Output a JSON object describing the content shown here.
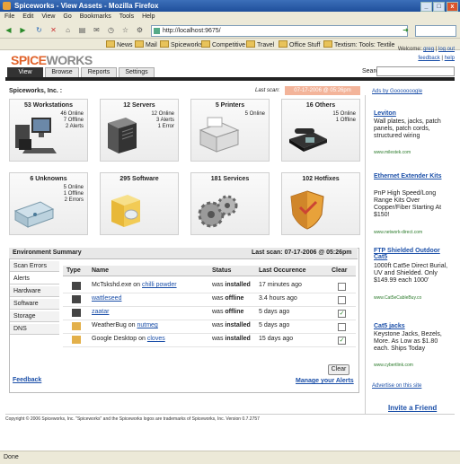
{
  "window": {
    "title": "Spiceworks - View Assets - Mozilla Firefox"
  },
  "menu": [
    "File",
    "Edit",
    "View",
    "Go",
    "Bookmarks",
    "Tools",
    "Help"
  ],
  "nav": {
    "url": "http://localhost:9675/"
  },
  "bookmarks": [
    "News",
    "Mail",
    "Spiceworks",
    "Competitive",
    "Travel",
    "Office Stuff",
    "Textism: Tools: Textile"
  ],
  "header": {
    "logo_left": "SPICE",
    "logo_right": "WORKS",
    "welcome_prefix": "Welcome:",
    "user": "greg",
    "logout": "log out",
    "feedback": "feedback",
    "help": "help",
    "tabs": [
      "View",
      "Browse",
      "Reports",
      "Settings"
    ],
    "search_label": "Search:"
  },
  "main": {
    "title": "Spiceworks, Inc. :",
    "last_scan_label": "Last scan:",
    "last_scan_value": "07-17-2006 @ 05:26pm"
  },
  "cards": [
    {
      "title": "53 Workstations",
      "stats": [
        "46 Online",
        "7 Offline",
        "2 Alerts"
      ],
      "icon": "workstation-icon"
    },
    {
      "title": "12 Servers",
      "stats": [
        "12 Online",
        "3 Alerts",
        "1 Error"
      ],
      "icon": "server-icon"
    },
    {
      "title": "5 Printers",
      "stats": [
        "5 Online"
      ],
      "icon": "printer-icon"
    },
    {
      "title": "16 Others",
      "stats": [
        "15 Online",
        "1 Offline"
      ],
      "icon": "phone-icon"
    },
    {
      "title": "6 Unknowns",
      "stats": [
        "5 Online",
        "1 Offline",
        "2 Errors"
      ],
      "icon": "unknown-device-icon"
    },
    {
      "title": "295 Software",
      "stats": [],
      "icon": "software-box-icon"
    },
    {
      "title": "181 Services",
      "stats": [],
      "icon": "gears-icon"
    },
    {
      "title": "102 Hotfixes",
      "stats": [],
      "icon": "shield-icon"
    }
  ],
  "env": {
    "title": "Environment Summary",
    "last_scan": "Last scan: 07-17-2006 @ 05:26pm",
    "side_tabs": [
      "Scan Errors",
      "Alerts",
      "Hardware",
      "Software",
      "Storage",
      "DNS"
    ],
    "feedback": "Feedback",
    "columns": [
      "Type",
      "Name",
      "Status",
      "Last Occurence",
      "Clear"
    ],
    "rows": [
      {
        "icon": "computer-icon",
        "name_pre": "McTskshd.exe on ",
        "name_link": "chilli powder",
        "status_pre": "was ",
        "status_bold": "installed",
        "when": "17 minutes ago",
        "checked": false
      },
      {
        "icon": "computer-icon",
        "name_pre": "",
        "name_link": "wattleseed",
        "status_pre": "was ",
        "status_bold": "offline",
        "when": "3.4 hours ago",
        "checked": false
      },
      {
        "icon": "computer-icon",
        "name_pre": "",
        "name_link": "zaatar",
        "status_pre": "was ",
        "status_bold": "offline",
        "when": "5 days ago",
        "checked": true
      },
      {
        "icon": "software-icon",
        "name_pre": "WeatherBug on ",
        "name_link": "nutmeg",
        "status_pre": "was ",
        "status_bold": "installed",
        "when": "5 days ago",
        "checked": false
      },
      {
        "icon": "software-icon",
        "name_pre": "Google Desktop on ",
        "name_link": "cloves",
        "status_pre": "was ",
        "status_bold": "installed",
        "when": "15 days ago",
        "checked": true
      }
    ],
    "clear_button": "Clear",
    "manage_alerts": "Manage your Alerts"
  },
  "ads": {
    "ads_by": "Ads by Gooooooogle",
    "items": [
      {
        "title": "Leviton",
        "text": "Wall plates, jacks, patch panels, patch cords, structured wiring",
        "url": "www.milestek.com"
      },
      {
        "title": "Ethernet Extender Kits",
        "text": "PnP High Speed/Long Range Kits Over Copper/Fiber Starting At $150!",
        "url": "www.network-direct.com"
      },
      {
        "title": "FTP Shielded Outdoor Cat5",
        "text": "1000ft Cat5e Direct Burial, UV and Shielded. Only $149.99 each 1000'",
        "url": "www.Cat5eCableBuy.co"
      },
      {
        "title": "Cat5 jacks",
        "text": "Keystone Jacks, Bezels, More. As Low as $1.80 each. Ships Today",
        "url": "www.cybertlink.com"
      }
    ],
    "advertise": "Advertise on this site",
    "invite": "Invite a Friend"
  },
  "footer": {
    "copyright": "Copyright © 2006 Spiceworks, Inc. \"Spiceworks\" and the Spiceworks logos are trademarks of Spiceworks, Inc. Version 0.7.2757"
  },
  "status": {
    "text": "Done"
  },
  "colors": {
    "brand_orange": "#e0622a",
    "link": "#1b4fa8",
    "scan_badge": "#f3b49a"
  }
}
